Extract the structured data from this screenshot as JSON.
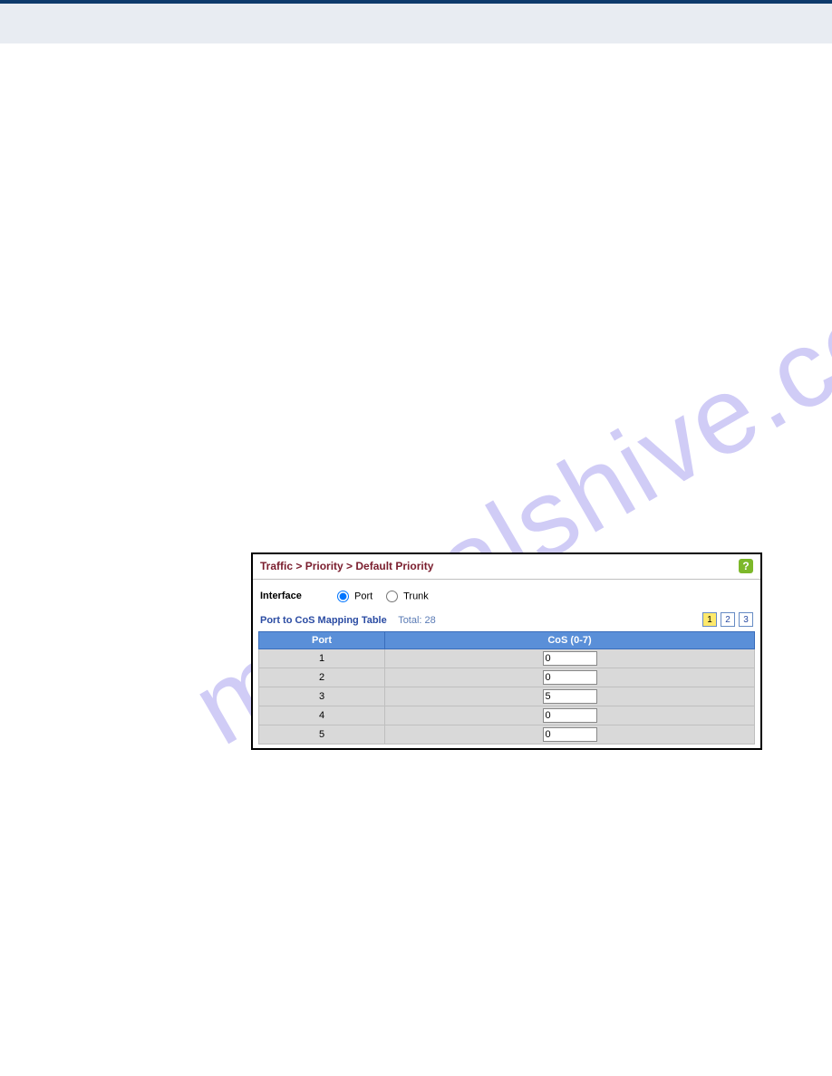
{
  "watermark_text": "manualshive.com",
  "panel": {
    "breadcrumb": "Traffic > Priority > Default Priority",
    "help_icon": "?",
    "interface_label": "Interface",
    "radio_port_label": "Port",
    "radio_trunk_label": "Trunk",
    "table_title": "Port to CoS Mapping Table",
    "table_total": "Total: 28",
    "pager": [
      "1",
      "2",
      "3"
    ],
    "headers": {
      "port": "Port",
      "cos": "CoS (0-7)"
    },
    "rows": [
      {
        "port": "1",
        "cos": "0"
      },
      {
        "port": "2",
        "cos": "0"
      },
      {
        "port": "3",
        "cos": "5"
      },
      {
        "port": "4",
        "cos": "0"
      },
      {
        "port": "5",
        "cos": "0"
      }
    ]
  }
}
